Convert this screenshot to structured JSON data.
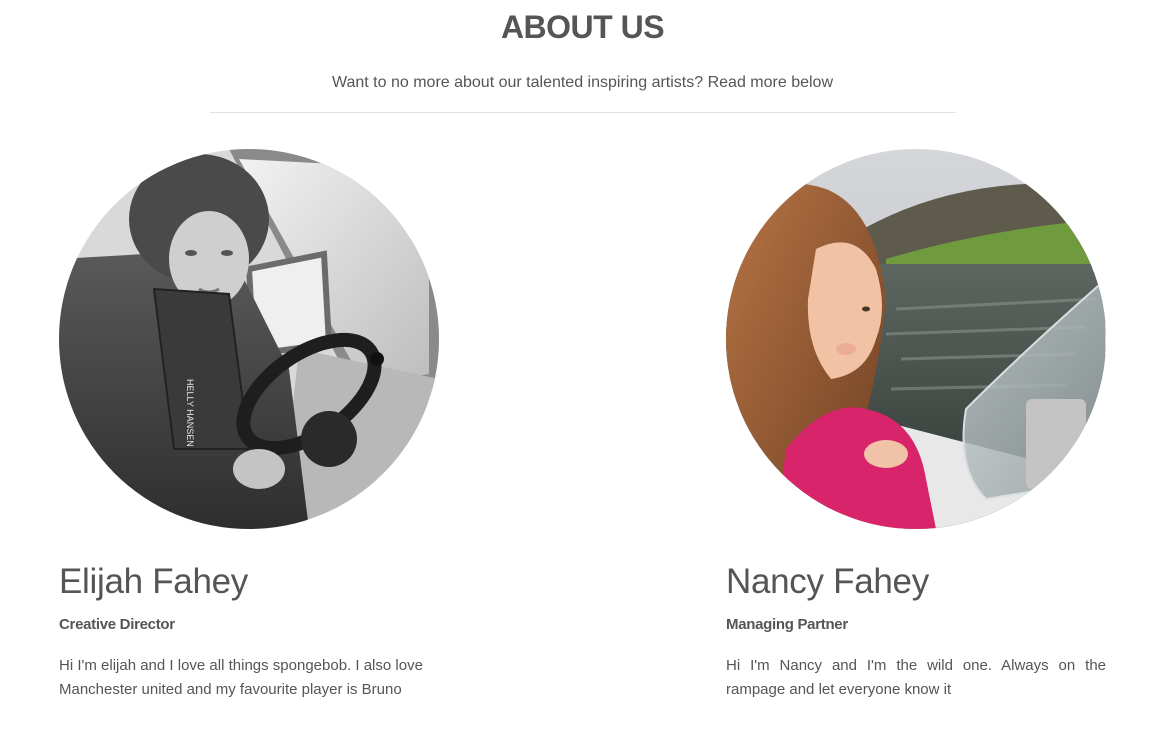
{
  "header": {
    "title": "ABOUT US",
    "subtitle": "Want to no more about our talented inspiring artists? Read more below"
  },
  "team": [
    {
      "name": "Elijah Fahey",
      "role": "Creative Director",
      "bio": "Hi I'm elijah and I love all things spongebob. I also love Manchester united and my favourite player is Bruno",
      "photo_caption": "HELLY HANSEN"
    },
    {
      "name": "Nancy Fahey",
      "role": "Managing Partner",
      "bio": "Hi I'm Nancy and I'm the wild one. Always on the rampage and let everyone know it"
    }
  ]
}
